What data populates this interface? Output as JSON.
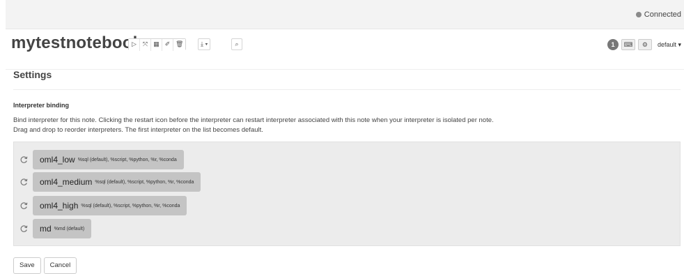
{
  "status": {
    "text": "Connected",
    "dot_color": "#8a8a8a"
  },
  "notebook": {
    "title": "mytestnotebook"
  },
  "toolbar": {
    "group1": [
      {
        "icon": "play-icon",
        "glyph": "▷"
      },
      {
        "icon": "expand-icon",
        "glyph": "⤧"
      },
      {
        "icon": "book-icon",
        "glyph": "▦"
      },
      {
        "icon": "eraser-icon",
        "glyph": "✐"
      },
      {
        "icon": "trash-icon",
        "glyph": "🗑"
      }
    ],
    "export_glyph": "⤓ ▾",
    "search_glyph": "⌕"
  },
  "right_tools": {
    "badge": "1",
    "keyboard_glyph": "⌨",
    "gear_glyph": "⚙",
    "default_label": "default ▾"
  },
  "settings": {
    "title": "Settings",
    "section_title": "Interpreter binding",
    "desc_line1": "Bind interpreter for this note. Clicking the restart icon before the interpreter can restart interpreter associated with this note when your interpreter is isolated per note.",
    "desc_line2": "Drag and drop to reorder interpreters. The first interpreter on the list becomes default."
  },
  "interpreters": [
    {
      "name": "oml4_low",
      "modes": "%sql (default), %script, %python, %r, %conda"
    },
    {
      "name": "oml4_medium",
      "modes": "%sql (default), %script, %python, %r, %conda"
    },
    {
      "name": "oml4_high",
      "modes": "%sql (default), %script, %python, %r, %conda"
    },
    {
      "name": "md",
      "modes": "%md (default)"
    }
  ],
  "actions": {
    "save": "Save",
    "cancel": "Cancel"
  }
}
